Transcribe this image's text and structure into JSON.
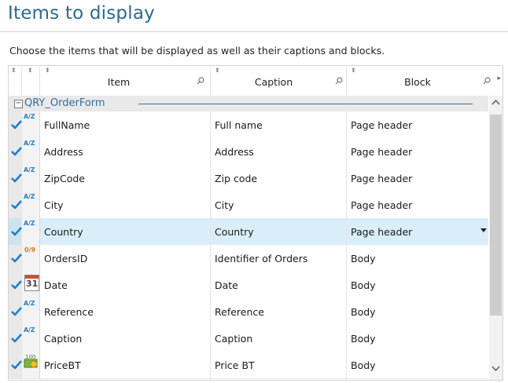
{
  "page": {
    "title": "Items to display",
    "subtitle": "Choose the items that will be displayed as well as their captions and blocks."
  },
  "grid": {
    "columns": [
      {
        "key": "check",
        "label": ""
      },
      {
        "key": "type",
        "label": ""
      },
      {
        "key": "item",
        "label": "Item"
      },
      {
        "key": "caption",
        "label": "Caption"
      },
      {
        "key": "block",
        "label": "Block"
      }
    ],
    "group": {
      "label": "QRY_OrderForm",
      "expanded": true
    },
    "rows": [
      {
        "checked": true,
        "type": "text",
        "type_label": "A/Z",
        "item": "FullName",
        "caption": "Full name",
        "block": "Page header"
      },
      {
        "checked": true,
        "type": "text",
        "type_label": "A/Z",
        "item": "Address",
        "caption": "Address",
        "block": "Page header"
      },
      {
        "checked": true,
        "type": "text",
        "type_label": "A/Z",
        "item": "ZipCode",
        "caption": "Zip code",
        "block": "Page header"
      },
      {
        "checked": true,
        "type": "text",
        "type_label": "A/Z",
        "item": "City",
        "caption": "City",
        "block": "Page header"
      },
      {
        "checked": true,
        "type": "text",
        "type_label": "A/Z",
        "item": "Country",
        "caption": "Country",
        "block": "Page header",
        "selected": true
      },
      {
        "checked": true,
        "type": "numeric",
        "type_label": "0/9",
        "item": "OrdersID",
        "caption": "Identifier of Orders",
        "block": "Body"
      },
      {
        "checked": true,
        "type": "date",
        "type_label": "31",
        "item": "Date",
        "caption": "Date",
        "block": "Body"
      },
      {
        "checked": true,
        "type": "text",
        "type_label": "A/Z",
        "item": "Reference",
        "caption": "Reference",
        "block": "Body"
      },
      {
        "checked": true,
        "type": "text",
        "type_label": "A/Z",
        "item": "Caption",
        "caption": "Caption",
        "block": "Body"
      },
      {
        "checked": true,
        "type": "currency",
        "type_label": "100",
        "item": "PriceBT",
        "caption": "Price BT",
        "block": "Body"
      }
    ]
  },
  "colors": {
    "accent": "#2c6a8e",
    "check": "#1e7fd0",
    "selected_row": "#d9eef8",
    "group_bg": "#e9e9e9"
  },
  "icons": {
    "sort": "sort-arrows-icon",
    "search": "search-icon",
    "dropdown": "dropdown-arrow-icon"
  }
}
